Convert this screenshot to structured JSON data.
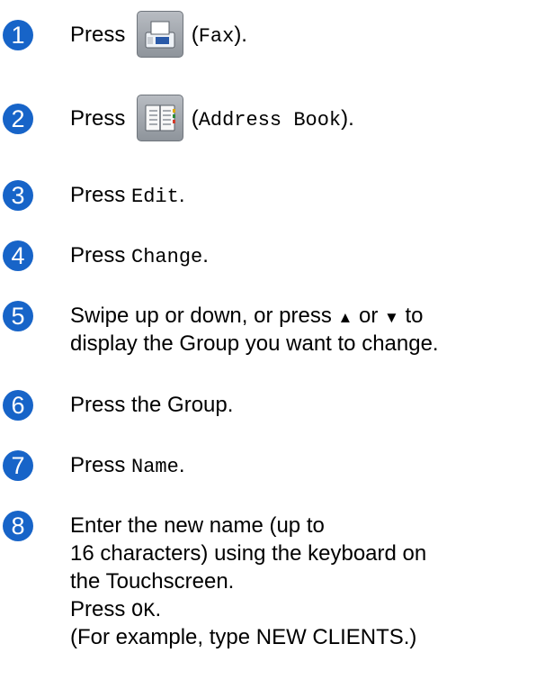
{
  "steps": [
    {
      "num": "1",
      "press": "Press",
      "code": "Fax",
      "open": "(",
      "close": ")."
    },
    {
      "num": "2",
      "press": "Press",
      "code": "Address Book",
      "open": "(",
      "close": ")."
    },
    {
      "num": "3",
      "press": "Press",
      "code": "Edit",
      "end": "."
    },
    {
      "num": "4",
      "press": "Press",
      "code": "Change",
      "end": "."
    },
    {
      "num": "5",
      "line1_a": "Swipe up or down, or press",
      "up": "▲",
      "or": "or",
      "down": "▼",
      "to": "to",
      "line2": "display the Group you want to change."
    },
    {
      "num": "6",
      "text": "Press the Group."
    },
    {
      "num": "7",
      "press": "Press",
      "code": "Name",
      "end": "."
    },
    {
      "num": "8",
      "line1": "Enter the new name (up to",
      "line2": "16 characters) using the keyboard on",
      "line3": "the Touchscreen.",
      "press": "Press",
      "code": "OK",
      "end": ".",
      "line5": "(For example, type NEW CLIENTS.)"
    }
  ],
  "icons": {
    "fax": "fax-icon",
    "address_book": "address-book-icon"
  },
  "colors": {
    "step_badge": "#1764c8"
  }
}
